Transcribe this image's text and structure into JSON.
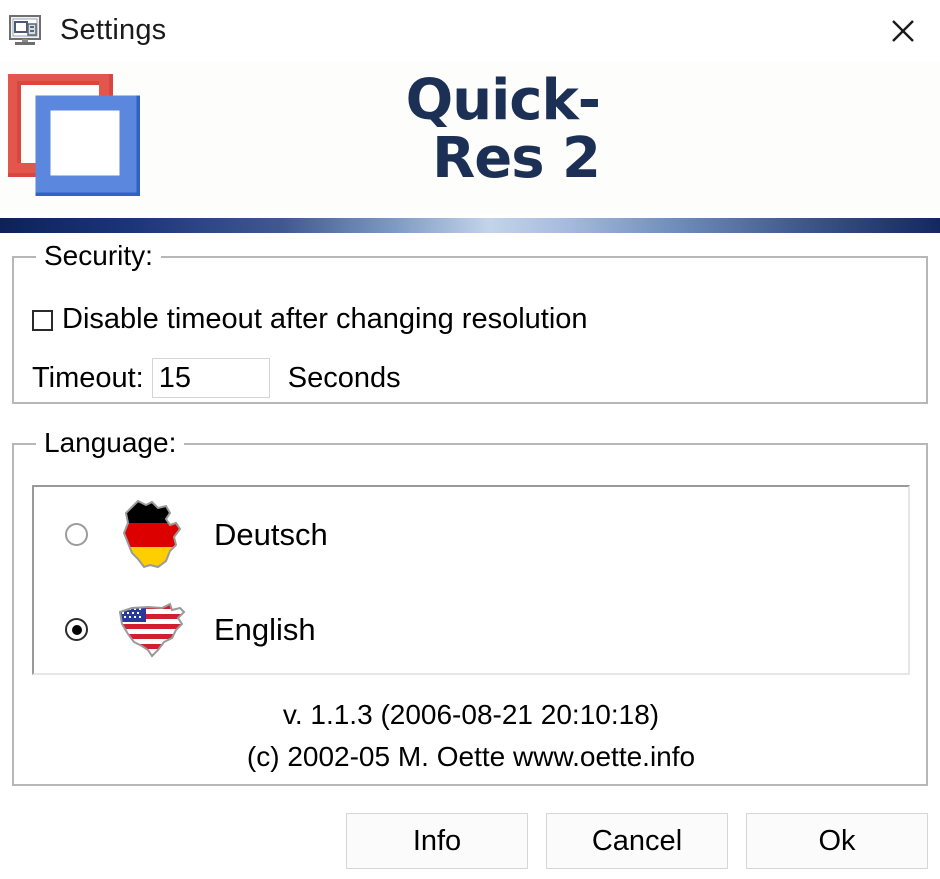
{
  "window": {
    "title": "Settings",
    "icon": "monitor-settings-icon",
    "close_label": "✕"
  },
  "banner": {
    "logo_icon": "quickres-overlapping-squares-logo",
    "brand_line1": "Quick-",
    "brand_line2": "Res 2",
    "brand_color": "#1c3055",
    "gradient_dark": "#0c2257",
    "gradient_light": "#c3d4ea"
  },
  "security": {
    "group_title": "Security:",
    "disable_timeout_label": "Disable timeout after changing resolution",
    "disable_timeout_checked": false,
    "timeout_label": "Timeout:",
    "timeout_value": "15",
    "timeout_placeholder": "",
    "seconds_label": "Seconds"
  },
  "language": {
    "group_title": "Language:",
    "options": [
      {
        "label": "Deutsch",
        "flag": "germany-map-flag-icon",
        "selected": false
      },
      {
        "label": "English",
        "flag": "usa-map-flag-icon",
        "selected": true
      }
    ]
  },
  "about": {
    "version_line": "v. 1.1.3 (2006-08-21 20:10:18)",
    "copyright_line": "(c) 2002-05 M. Oette www.oette.info"
  },
  "footer": {
    "info_label": "Info",
    "cancel_label": "Cancel",
    "ok_label": "Ok"
  }
}
